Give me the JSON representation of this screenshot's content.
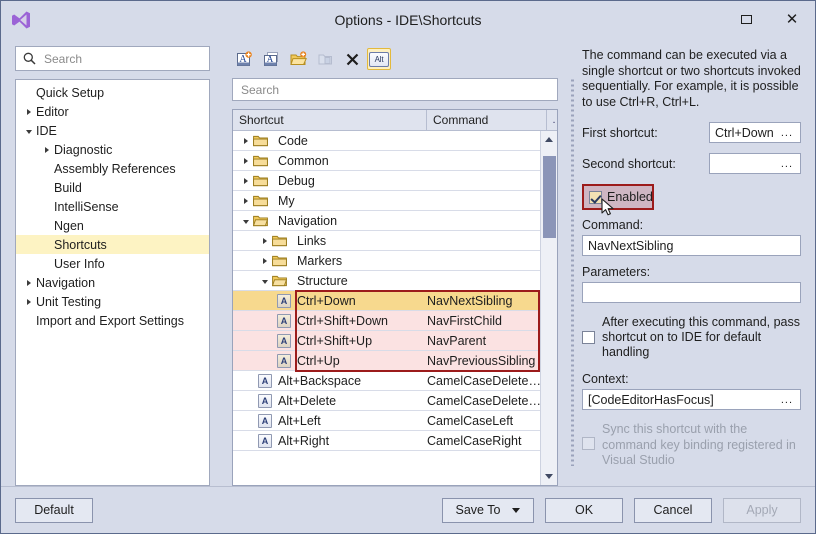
{
  "window": {
    "title": "Options - IDE\\Shortcuts",
    "logo_icon": "visual-studio-logo",
    "maximize_icon": "maximize-icon",
    "close_icon": "close-icon"
  },
  "left": {
    "search": {
      "placeholder": "Search",
      "value": "",
      "icon": "search-icon"
    },
    "tree": [
      {
        "label": "Quick Setup",
        "indent": 1,
        "arrow": "none",
        "selected": false
      },
      {
        "label": "Editor",
        "indent": 1,
        "arrow": "collapsed",
        "selected": false
      },
      {
        "label": "IDE",
        "indent": 1,
        "arrow": "expanded",
        "selected": false
      },
      {
        "label": "Diagnostic",
        "indent": 2,
        "arrow": "collapsed",
        "selected": false
      },
      {
        "label": "Assembly References",
        "indent": 2,
        "arrow": "none",
        "selected": false
      },
      {
        "label": "Build",
        "indent": 2,
        "arrow": "none",
        "selected": false
      },
      {
        "label": "IntelliSense",
        "indent": 2,
        "arrow": "none",
        "selected": false
      },
      {
        "label": "Ngen",
        "indent": 2,
        "arrow": "none",
        "selected": false
      },
      {
        "label": "Shortcuts",
        "indent": 2,
        "arrow": "none",
        "selected": true
      },
      {
        "label": "User Info",
        "indent": 2,
        "arrow": "none",
        "selected": false
      },
      {
        "label": "Navigation",
        "indent": 1,
        "arrow": "collapsed",
        "selected": false
      },
      {
        "label": "Unit Testing",
        "indent": 1,
        "arrow": "collapsed",
        "selected": false
      },
      {
        "label": "Import and Export Settings",
        "indent": 1,
        "arrow": "none",
        "selected": false
      }
    ]
  },
  "middle": {
    "toolbar": [
      {
        "name": "add-shortcut-icon",
        "tooltip": "Add Shortcut",
        "state": "enabled"
      },
      {
        "name": "edit-shortcut-icon",
        "tooltip": "Edit Shortcut",
        "state": "enabled"
      },
      {
        "name": "open-folder-icon",
        "tooltip": "New Folder",
        "state": "enabled"
      },
      {
        "name": "copy-icon",
        "tooltip": "Copy",
        "state": "disabled"
      },
      {
        "name": "delete-x-icon",
        "tooltip": "Delete",
        "state": "enabled"
      },
      {
        "name": "alt-key-icon",
        "tooltip": "Alt",
        "state": "active",
        "label": "Alt"
      }
    ],
    "search": {
      "placeholder": "Search",
      "value": ""
    },
    "columns": {
      "shortcut": "Shortcut",
      "command": "Command",
      "extra": ".."
    },
    "rows": [
      {
        "type": "folder",
        "indent": 0,
        "arrow": "collapsed",
        "open": false,
        "shortcut": "Code",
        "command": "",
        "extra": "",
        "highlight": "none"
      },
      {
        "type": "folder",
        "indent": 0,
        "arrow": "collapsed",
        "open": false,
        "shortcut": "Common",
        "command": "",
        "extra": "",
        "highlight": "none"
      },
      {
        "type": "folder",
        "indent": 0,
        "arrow": "collapsed",
        "open": false,
        "shortcut": "Debug",
        "command": "",
        "extra": "",
        "highlight": "none"
      },
      {
        "type": "folder",
        "indent": 0,
        "arrow": "collapsed",
        "open": false,
        "shortcut": "My",
        "command": "",
        "extra": "",
        "highlight": "none"
      },
      {
        "type": "folder",
        "indent": 0,
        "arrow": "expanded",
        "open": true,
        "shortcut": "Navigation",
        "command": "",
        "extra": "",
        "highlight": "none"
      },
      {
        "type": "folder",
        "indent": 1,
        "arrow": "collapsed",
        "open": false,
        "shortcut": "Links",
        "command": "",
        "extra": "",
        "highlight": "none"
      },
      {
        "type": "folder",
        "indent": 1,
        "arrow": "collapsed",
        "open": false,
        "shortcut": "Markers",
        "command": "",
        "extra": "",
        "highlight": "none"
      },
      {
        "type": "folder",
        "indent": 1,
        "arrow": "expanded",
        "open": true,
        "shortcut": "Structure",
        "command": "",
        "extra": "",
        "highlight": "none"
      },
      {
        "type": "shortcut",
        "indent": 2,
        "shortcut": "Ctrl+Down",
        "command": "NavNextSibling",
        "extra": ".",
        "highlight": "primary"
      },
      {
        "type": "shortcut",
        "indent": 2,
        "shortcut": "Ctrl+Shift+Down",
        "command": "NavFirstChild",
        "extra": ".",
        "highlight": "group"
      },
      {
        "type": "shortcut",
        "indent": 2,
        "shortcut": "Ctrl+Shift+Up",
        "command": "NavParent",
        "extra": ".",
        "highlight": "group"
      },
      {
        "type": "shortcut",
        "indent": 2,
        "shortcut": "Ctrl+Up",
        "command": "NavPreviousSibling",
        "extra": ".",
        "highlight": "group"
      },
      {
        "type": "shortcut",
        "indent": 1,
        "shortcut": "Alt+Backspace",
        "command": "CamelCaseDeleteLeft",
        "extra": ".",
        "highlight": "none"
      },
      {
        "type": "shortcut",
        "indent": 1,
        "shortcut": "Alt+Delete",
        "command": "CamelCaseDeleteRi...",
        "extra": ".",
        "highlight": "none"
      },
      {
        "type": "shortcut",
        "indent": 1,
        "shortcut": "Alt+Left",
        "command": "CamelCaseLeft",
        "extra": ".",
        "highlight": "none"
      },
      {
        "type": "shortcut",
        "indent": 1,
        "shortcut": "Alt+Right",
        "command": "CamelCaseRight",
        "extra": ".",
        "highlight": "none"
      }
    ],
    "scrollbar": {
      "up_icon": "scroll-up-icon",
      "down_icon": "scroll-down-icon"
    }
  },
  "right": {
    "description": "The command can be executed via a single shortcut or two shortcuts invoked sequentially. For example, it is possible to use Ctrl+R, Ctrl+L.",
    "first_shortcut": {
      "label": "First shortcut:",
      "value": "Ctrl+Down",
      "ellipsis": "..."
    },
    "second_shortcut": {
      "label": "Second shortcut:",
      "value": "",
      "ellipsis": "..."
    },
    "enabled": {
      "label": "Enabled",
      "checked": true
    },
    "command": {
      "label": "Command:",
      "value": "NavNextSibling"
    },
    "parameters": {
      "label": "Parameters:",
      "value": ""
    },
    "pass_shortcut": {
      "label": "After executing this command, pass shortcut on to IDE for default handling",
      "checked": false
    },
    "context": {
      "label": "Context:",
      "value": "[CodeEditorHasFocus]",
      "ellipsis": "..."
    },
    "sync": {
      "label": "Sync this shortcut with the command key binding registered in Visual Studio",
      "checked": false,
      "disabled": true
    },
    "cursor_icon": "mouse-pointer-icon"
  },
  "footer": {
    "default": "Default",
    "save_to": "Save To",
    "ok": "OK",
    "cancel": "Cancel",
    "apply": "Apply"
  },
  "colors": {
    "window_bg": "#d6dbe9",
    "accent_selection": "#f7d98e",
    "group_selection": "#fbe2e2",
    "highlight_outline": "#9c1b1b",
    "tree_selection": "#fdf3c3"
  }
}
